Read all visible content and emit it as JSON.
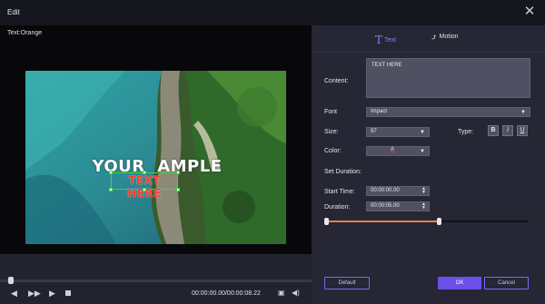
{
  "window": {
    "title": "Edit",
    "close_icon": "close-icon"
  },
  "preview": {
    "label": "Text:Orange",
    "overlay_title": "YOUR   AMPLE",
    "overlay_text": "TEXT HERE"
  },
  "player": {
    "timecode": "00:00:00.00/00:00:08.22",
    "progress": 0.0,
    "icons": [
      "prev-icon",
      "fast-forward-icon",
      "play-icon",
      "stop-icon",
      "snapshot-icon",
      "volume-icon"
    ]
  },
  "tabs": [
    {
      "label": "Text",
      "icon": "text-icon",
      "active": true
    },
    {
      "label": "Motion",
      "icon": "motion-icon",
      "active": false
    }
  ],
  "form": {
    "content_label": "Content:",
    "content_value": "TEXT HERE",
    "font_label": "Font",
    "font_value": "Impact",
    "size_label": "Size:",
    "size_value": "97",
    "type_label": "Type:",
    "type_buttons": [
      "B",
      "I",
      "U"
    ],
    "color_label": "Color:",
    "color_value": "A",
    "set_duration_label": "Set Duration:",
    "start_time_label": "Start Time:",
    "start_time_value": "00:00:00.00",
    "duration_label": "Duration:",
    "duration_value": "00:00:05.00",
    "range_start": 0.0,
    "range_end": 0.56
  },
  "buttons": {
    "default": "Default",
    "ok": "OK",
    "cancel": "Cancel"
  },
  "colors": {
    "accent": "#6b4fe8",
    "range": "#e8804a",
    "text_overlay": "#ff3b2e"
  }
}
